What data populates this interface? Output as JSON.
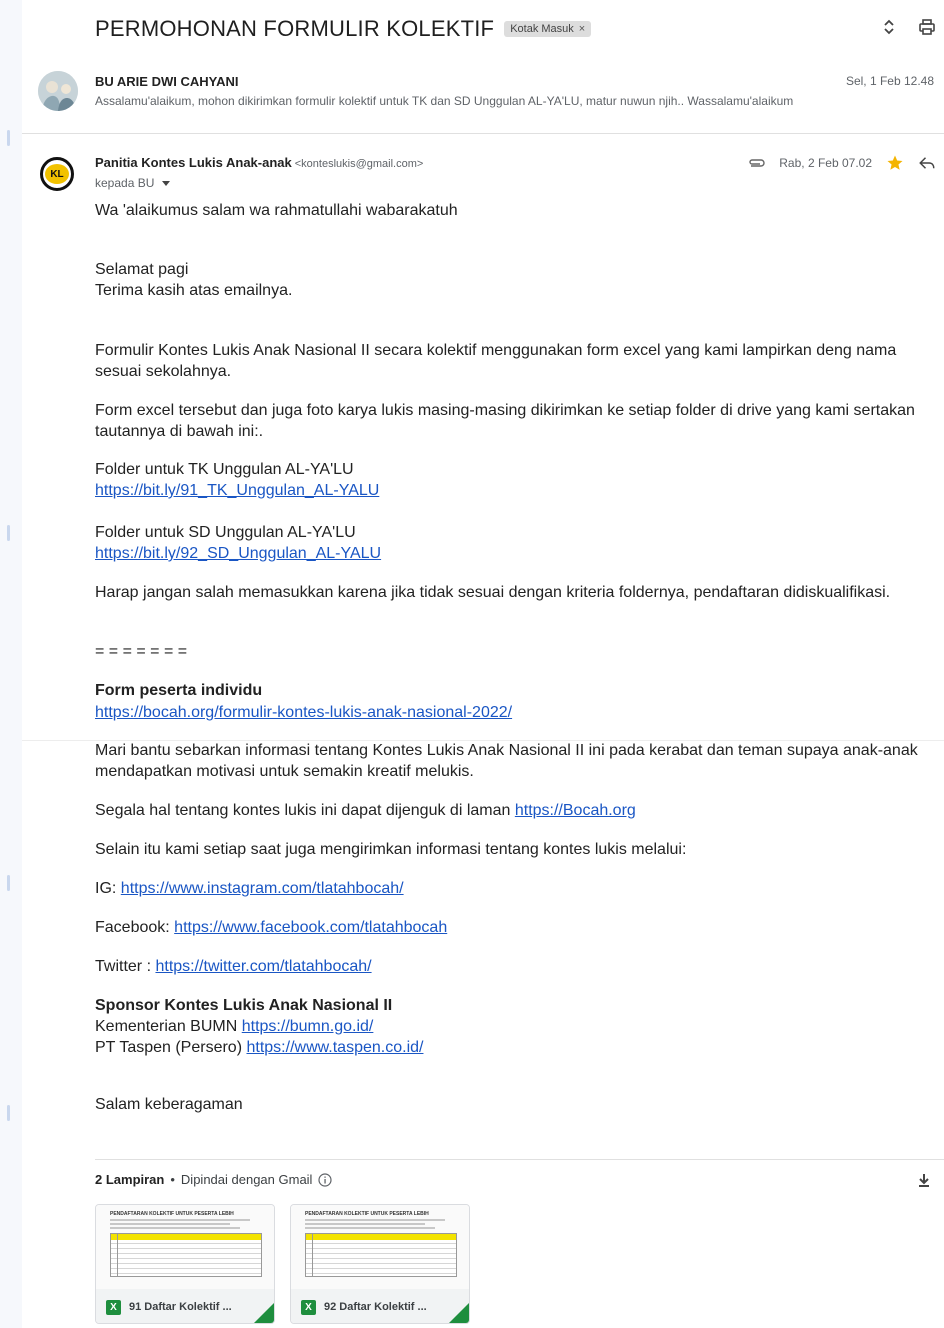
{
  "thread": {
    "subject": "PERMOHONAN FORMULIR KOLEKTIF",
    "label": "Kotak Masuk",
    "label_remove": "×"
  },
  "message1": {
    "sender": "BU ARIE DWI CAHYANI",
    "date": "Sel, 1 Feb 12.48",
    "snippet": "Assalamu'alaikum, mohon dikirimkan formulir kolektif untuk TK dan SD Unggulan AL-YA'LU, matur nuwun njih.. Wassalamu'alaikum"
  },
  "message2": {
    "avatar_text": "KL",
    "sender": "Panitia Kontes Lukis Anak-anak",
    "email": "<konteslukis@gmail.com>",
    "to": "kepada BU",
    "date": "Rab, 2 Feb 07.02",
    "body": {
      "greeting": "Wa 'alaikumus salam wa rahmatullahi wabarakatuh",
      "p1a": "Selamat pagi",
      "p1b": "Terima kasih atas emailnya.",
      "p2": "Formulir Kontes Lukis Anak Nasional II secara kolektif menggunakan form excel yang kami lampirkan deng nama sesuai sekolahnya.",
      "p3": "Form excel tersebut dan juga foto karya lukis masing-masing dikirimkan ke setiap folder di drive yang kami sertakan tautannya di bawah ini:.",
      "tk_label": "Folder untuk TK Unggulan AL-YA'LU",
      "tk_link": "https://bit.ly/91_TK_Unggulan_AL-YALU",
      "sd_label": "Folder untuk SD Unggulan AL-YA'LU",
      "sd_link": "https://bit.ly/92_SD_Unggulan_AL-YALU",
      "warning": "Harap jangan salah memasukkan karena jika tidak sesuai dengan kriteria foldernya, pendaftaran didiskualifikasi.",
      "separator": "= = = = = = =",
      "individual_title": "Form peserta individu",
      "individual_link": "https://bocah.org/formulir-kontes-lukis-anak-nasional-2022/",
      "share": "Mari bantu sebarkan informasi tentang Kontes Lukis Anak Nasional II ini pada kerabat dan teman supaya anak-anak mendapatkan motivasi untuk semakin kreatif melukis.",
      "site_text": "Segala hal tentang kontes lukis ini dapat dijenguk di laman",
      "site_link": "https://Bocah.org",
      "social_intro": "Selain itu kami setiap saat juga mengirimkan informasi tentang kontes lukis melalui:",
      "ig_label": "IG:",
      "ig_link": "https://www.instagram.com/tlatahbocah/",
      "fb_label": "Facebook:",
      "fb_link": "https://www.facebook.com/tlatahbocah",
      "tw_label": "Twitter :",
      "tw_link": "https://twitter.com/tlatahbocah/",
      "sponsor_title": "Sponsor Kontes Lukis Anak Nasional II",
      "sponsor1_label": "Kementerian BUMN",
      "sponsor1_link": "https://bumn.go.id/",
      "sponsor2_label": "PT Taspen (Persero)",
      "sponsor2_link": "https://www.taspen.co.id/",
      "closing": "Salam keberagaman"
    }
  },
  "attachments": {
    "count_label": "2 Lampiran",
    "dot": "•",
    "scan_text": "Dipindai dengan Gmail",
    "items": [
      {
        "name": "91 Daftar Kolektif ...",
        "preview_title": "PENDAFTARAN KOLEKTIF UNTUK PESERTA LEBIH",
        "type_icon": "X"
      },
      {
        "name": "92 Daftar Kolektif ...",
        "preview_title": "PENDAFTARAN KOLEKTIF UNTUK PESERTA LEBIH",
        "type_icon": "X"
      }
    ]
  },
  "colors": {
    "link": "#1a56c4",
    "star": "#f4b400",
    "excel": "#1e8e3e"
  }
}
